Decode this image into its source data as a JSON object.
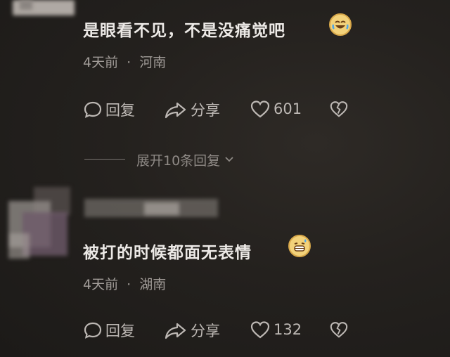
{
  "comments": [
    {
      "text": "是眼看不见，不是没痛觉吧",
      "emoji": "😂",
      "time": "4天前",
      "sep": "·",
      "location": "河南",
      "reply_label": "回复",
      "share_label": "分享",
      "likes": "601"
    },
    {
      "text": "被打的时候都面无表情",
      "emoji": "😁",
      "time": "4天前",
      "sep": "·",
      "location": "湖南",
      "reply_label": "回复",
      "share_label": "分享",
      "likes": "132"
    }
  ],
  "expand_replies": "展开10条回复",
  "icons": {
    "reply": "comment-bubble-icon",
    "share": "share-arrow-icon",
    "like": "heart-icon",
    "dislike": "broken-heart-icon",
    "expand": "chevron-down-icon"
  }
}
